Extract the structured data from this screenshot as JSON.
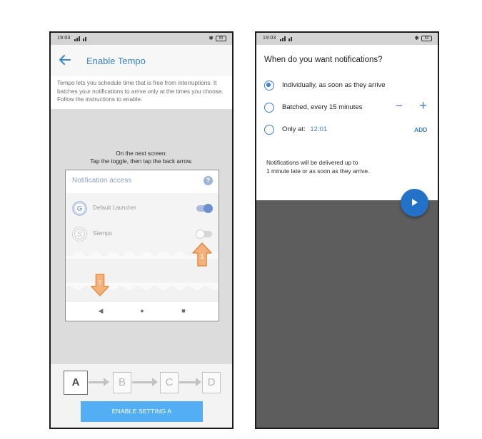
{
  "left_phone": {
    "status_bar": {
      "time": "19:03",
      "battery": "83"
    },
    "app_bar": {
      "title": "Enable Tempo",
      "back_icon": "arrow-left-icon"
    },
    "intro_text": "Tempo lets you schedule time that is free from interruptions. It batches your notifications to arrive only at the times you choose. Follow the instructions to enable:",
    "instruction_line1": "On the next screen:",
    "instruction_line2": "Tap the toggle, then tap the back arrow.",
    "mock_screen": {
      "title": "Notification access",
      "help_icon": "?",
      "apps": [
        {
          "label": "Default Launcher",
          "icon_letter": "G",
          "enabled": true
        },
        {
          "label": "Siempo",
          "icon_letter": "S",
          "enabled": false
        }
      ],
      "pointer_1": "1",
      "pointer_2": "2",
      "nav": {
        "back": "◀",
        "home": "●",
        "recents": "■"
      }
    },
    "steps": [
      "A",
      "B",
      "C",
      "D"
    ],
    "active_step": "A",
    "enable_button": "ENABLE SETTING A",
    "colors": {
      "accent": "#3b84d4",
      "button": "#54aef4",
      "pointer": "#f0a060"
    }
  },
  "right_phone": {
    "status_bar": {
      "time": "19:03",
      "battery": "83"
    },
    "question": "When do you want notifications?",
    "options": [
      {
        "label": "Individually, as soon as they arrive",
        "selected": true
      },
      {
        "label": "Batched, every 15 minutes",
        "selected": false,
        "minus": "−",
        "plus": "+"
      },
      {
        "label": "Only at:",
        "time": "12:01",
        "selected": false,
        "action": "ADD"
      }
    ],
    "note_line1": "Notifications will be delivered up to",
    "note_line2": "1 minute late or as soon as they arrive.",
    "fab_icon": "play-icon",
    "colors": {
      "accent": "#3d7fd0",
      "fab": "#2472c8",
      "overlay": "#5d5d5d"
    }
  }
}
